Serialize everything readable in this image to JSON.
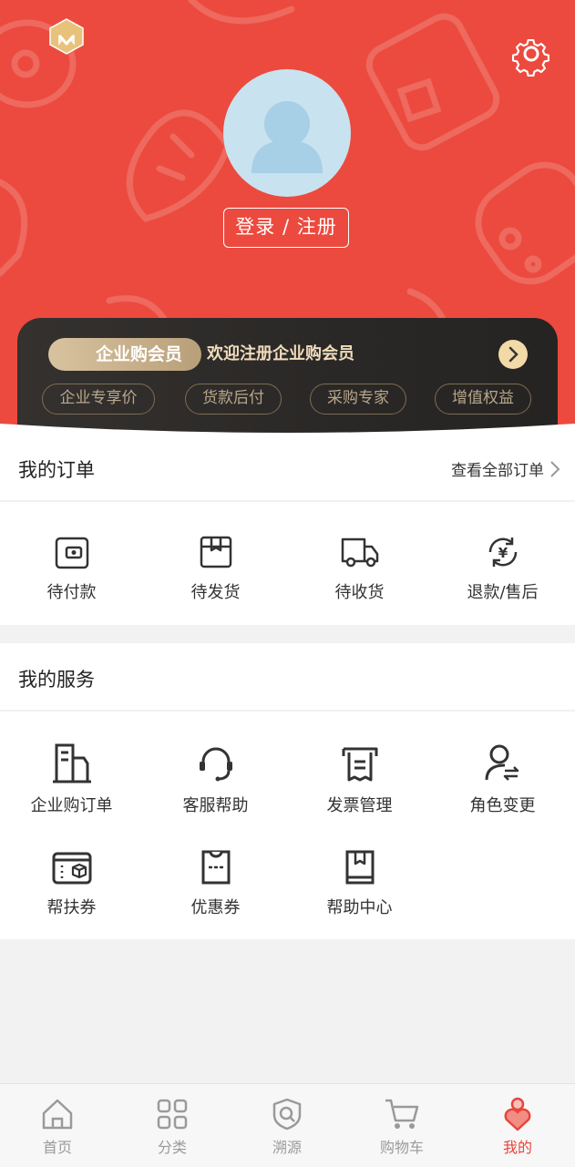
{
  "header": {
    "login_label": "登录 / 注册"
  },
  "member": {
    "badge_label": "企业购会员",
    "welcome_text": "欢迎注册企业购会员",
    "perks": [
      "企业专享价",
      "货款后付",
      "采购专家",
      "增值权益"
    ]
  },
  "orders": {
    "title": "我的订单",
    "view_all_label": "查看全部订单",
    "items": [
      {
        "label": "待付款",
        "icon": "wallet-icon"
      },
      {
        "label": "待发货",
        "icon": "package-icon"
      },
      {
        "label": "待收货",
        "icon": "truck-icon"
      },
      {
        "label": "退款/售后",
        "icon": "refund-icon"
      }
    ]
  },
  "services": {
    "title": "我的服务",
    "items": [
      {
        "label": "企业购订单",
        "icon": "building-icon"
      },
      {
        "label": "客服帮助",
        "icon": "headset-icon"
      },
      {
        "label": "发票管理",
        "icon": "invoice-icon"
      },
      {
        "label": "角色变更",
        "icon": "user-switch-icon"
      },
      {
        "label": "帮扶券",
        "icon": "aid-voucher-icon"
      },
      {
        "label": "优惠券",
        "icon": "coupon-icon"
      },
      {
        "label": "帮助中心",
        "icon": "help-book-icon"
      }
    ]
  },
  "tabbar": {
    "active": "我的",
    "items": [
      {
        "label": "首页",
        "icon": "home-icon"
      },
      {
        "label": "分类",
        "icon": "category-icon"
      },
      {
        "label": "溯源",
        "icon": "trace-icon"
      },
      {
        "label": "购物车",
        "icon": "cart-icon"
      },
      {
        "label": "我的",
        "icon": "profile-icon"
      }
    ]
  },
  "colors": {
    "brand_red": "#ec4a3f",
    "member_gold": "#f2d9a8",
    "tab_active": "#e8453c"
  }
}
